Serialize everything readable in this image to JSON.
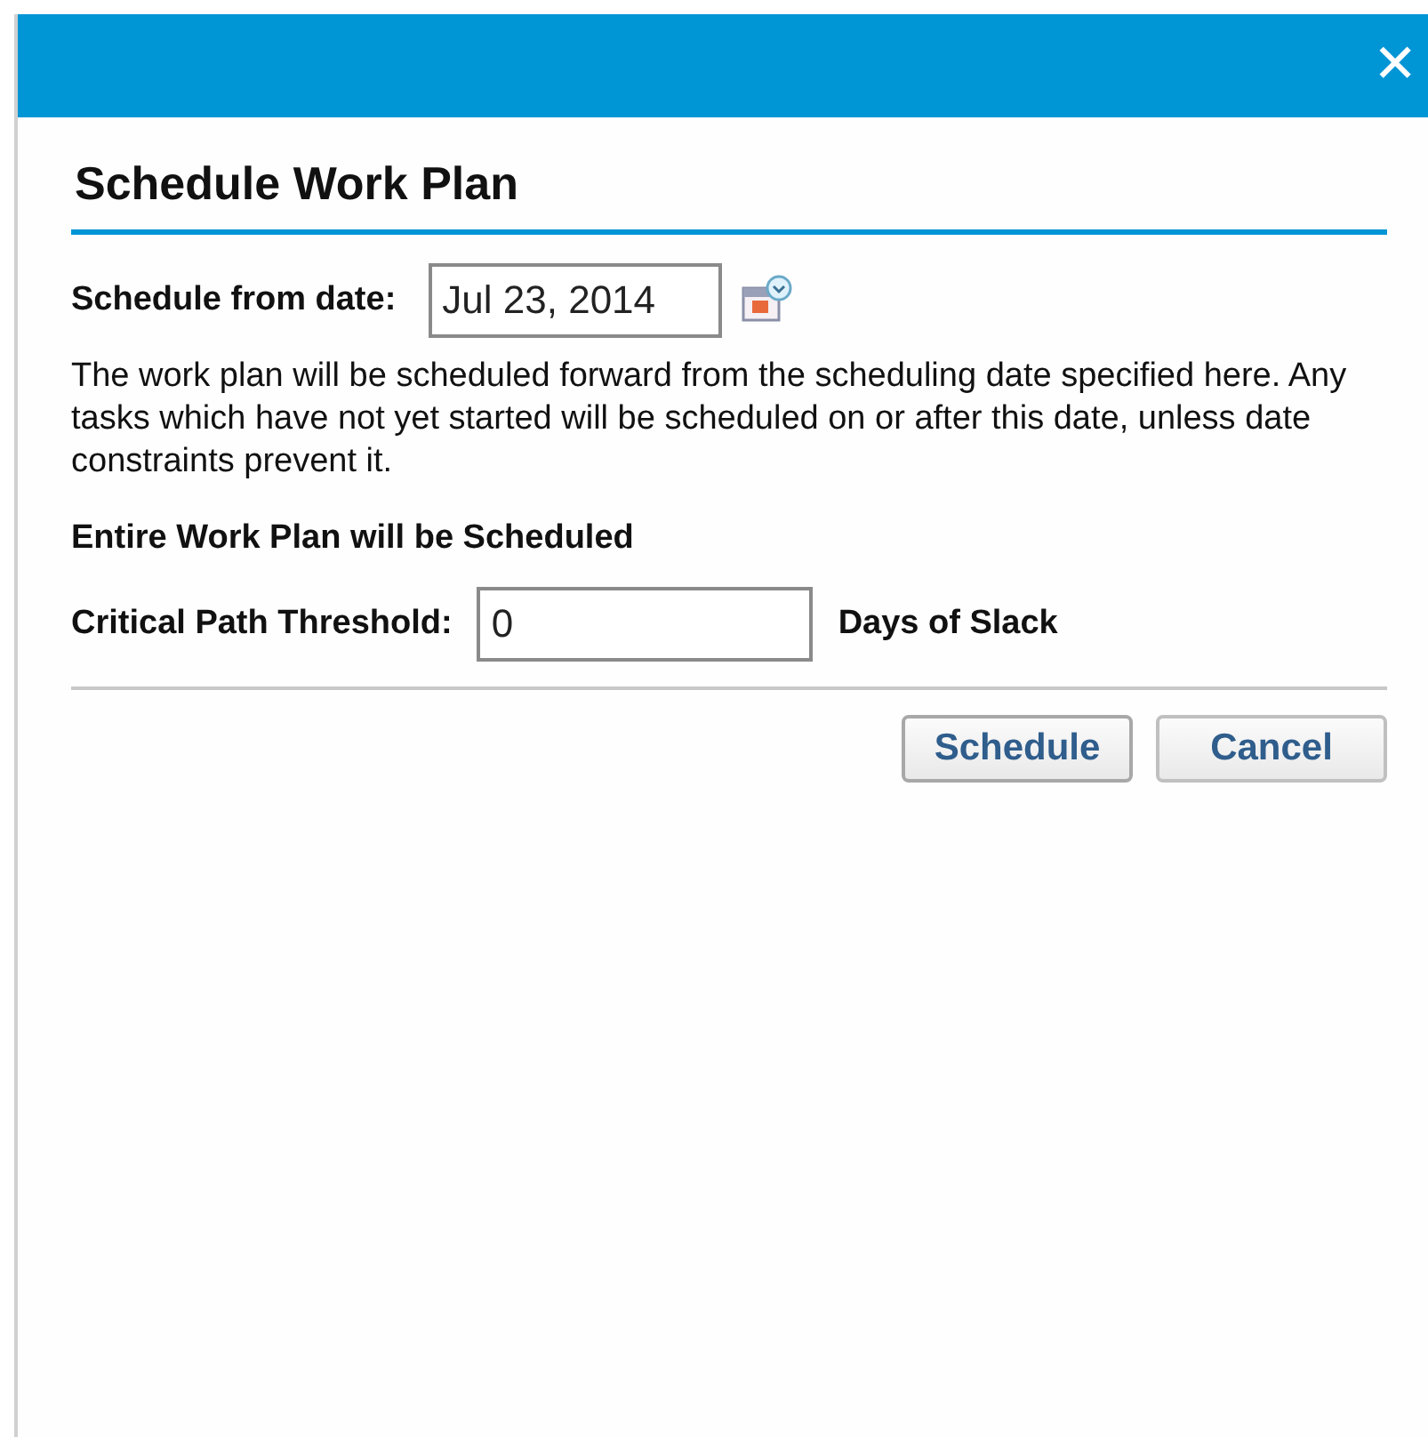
{
  "window": {
    "close_label": "✕"
  },
  "heading": "Schedule Work Plan",
  "date_field": {
    "label": "Schedule from date:",
    "value": "Jul 23, 2014"
  },
  "description": "The work plan will be scheduled forward from the scheduling date specified here. Any tasks which have not yet started will be scheduled on or after this date, unless date constraints prevent it.",
  "scope_note": "Entire Work Plan will be Scheduled",
  "threshold": {
    "label": "Critical Path Threshold:",
    "value": "0",
    "unit": "Days of Slack"
  },
  "buttons": [
    {
      "label": "Schedule",
      "kind": "primary"
    },
    {
      "label": "Cancel",
      "kind": "secondary"
    }
  ]
}
